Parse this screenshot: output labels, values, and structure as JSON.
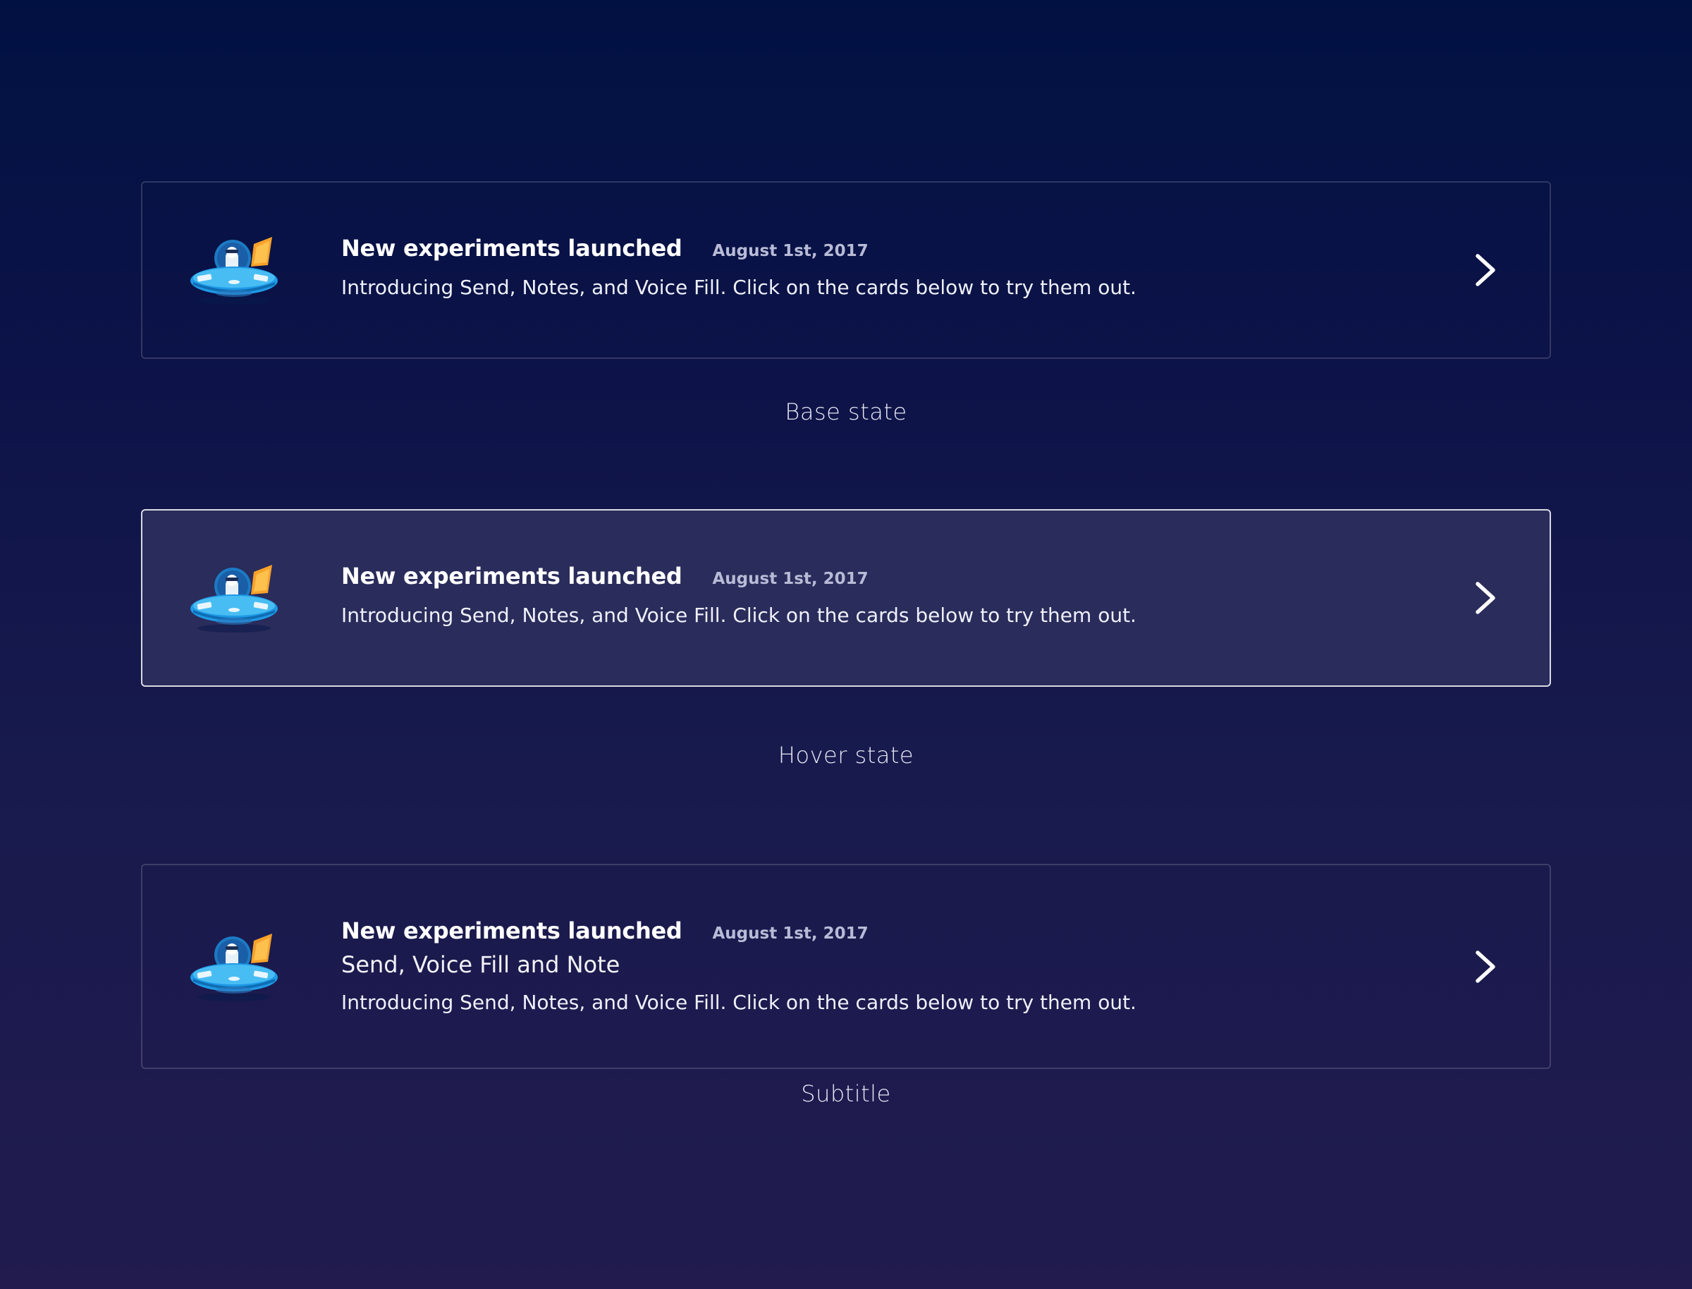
{
  "cards": [
    {
      "variant": "base",
      "icon": "ufo-icon",
      "title": "New experiments launched",
      "date": "August 1st, 2017",
      "description": "Introducing Send, Notes, and Voice Fill. Click on the cards below to try them out.",
      "chevron_icon": "chevron-right-icon"
    },
    {
      "variant": "hover",
      "icon": "ufo-icon",
      "title": "New experiments launched",
      "date": "August 1st, 2017",
      "description": "Introducing Send, Notes, and Voice Fill. Click on the cards below to try them out.",
      "chevron_icon": "chevron-right-icon"
    },
    {
      "variant": "subtitle",
      "icon": "ufo-icon",
      "title": "New experiments launched",
      "date": "August 1st, 2017",
      "subtitle": "Send, Voice Fill and Note",
      "description": "Introducing Send, Notes, and Voice Fill. Click on the cards below to try them out.",
      "chevron_icon": "chevron-right-icon"
    }
  ],
  "labels": {
    "base": "Base state",
    "hover": "Hover state",
    "subtitle": "Subtitle"
  },
  "colors": {
    "background_top": "#011142",
    "background_bottom": "#211b4e",
    "hover_card_bg": "#2a2c5b",
    "date_text": "#b8bbd6"
  }
}
